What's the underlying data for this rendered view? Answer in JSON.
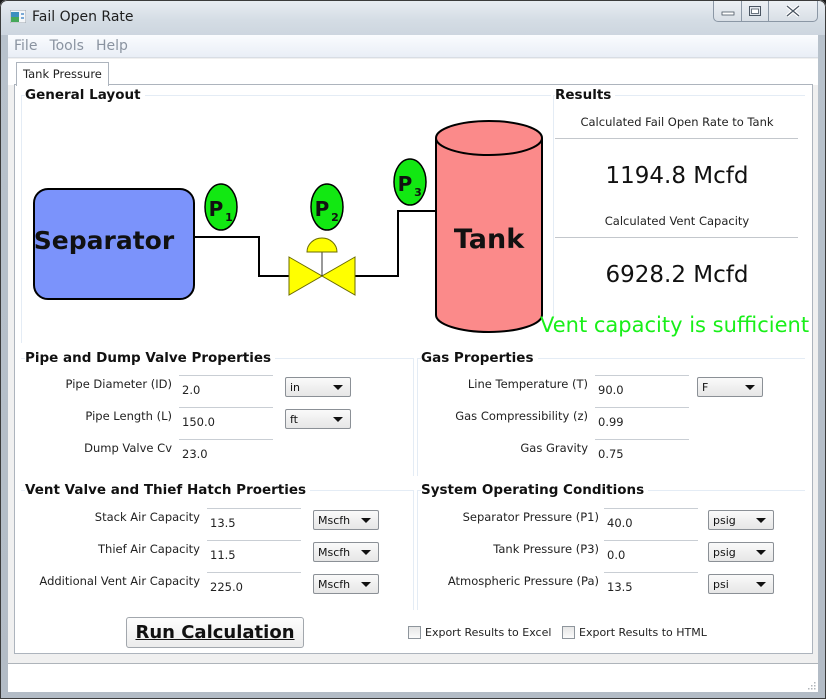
{
  "window": {
    "title": "Fail Open Rate",
    "icon": "app-window-icon",
    "controls": {
      "minimize": "minimize-icon",
      "maximize": "maximize-icon",
      "close": "close-icon"
    }
  },
  "menu": {
    "items": [
      {
        "label": "File"
      },
      {
        "label": "Tools"
      },
      {
        "label": "Help"
      }
    ]
  },
  "tabs": [
    {
      "label": "Tank Pressure",
      "active": true
    }
  ],
  "layout": {
    "title": "General Layout",
    "diagram": {
      "separator_label": "Separator",
      "tank_label": "Tank",
      "gauges": [
        {
          "p": "P",
          "sub": "1"
        },
        {
          "p": "P",
          "sub": "2"
        },
        {
          "p": "P",
          "sub": "3"
        }
      ],
      "colors": {
        "separator": "#7b93fb",
        "tank": "#fb8a8a",
        "gauge": "#12e812",
        "valve": "#ffff00"
      }
    }
  },
  "results": {
    "title": "Results",
    "fail_open_label": "Calculated Fail Open Rate to Tank",
    "fail_open_value": "1194.8 Mcfd",
    "vent_label": "Calculated Vent Capacity",
    "vent_value": "6928.2 Mcfd",
    "status_message": "Vent capacity is sufficient",
    "status_color": "#19ef19"
  },
  "pipe": {
    "title": "Pipe and Dump Valve Properties",
    "fields": [
      {
        "label": "Pipe Diameter (ID)",
        "value": "2.0",
        "unit": "in"
      },
      {
        "label": "Pipe Length (L)",
        "value": "150.0",
        "unit": "ft"
      },
      {
        "label": "Dump Valve Cv",
        "value": "23.0"
      }
    ]
  },
  "gas": {
    "title": "Gas Properties",
    "fields": [
      {
        "label": "Line Temperature (T)",
        "value": "90.0",
        "unit": "F"
      },
      {
        "label": "Gas Compressibility (z)",
        "value": "0.99"
      },
      {
        "label": "Gas Gravity",
        "value": "0.75"
      }
    ]
  },
  "vent": {
    "title": "Vent Valve and Thief Hatch Proerties",
    "fields": [
      {
        "label": "Stack Air Capacity",
        "value": "13.5",
        "unit": "Mscfh"
      },
      {
        "label": "Thief Air Capacity",
        "value": "11.5",
        "unit": "Mscfh"
      },
      {
        "label": "Additional Vent Air Capacity",
        "value": "225.0",
        "unit": "Mscfh"
      }
    ]
  },
  "system": {
    "title": "System Operating Conditions",
    "fields": [
      {
        "label": "Separator Pressure (P1)",
        "value": "40.0",
        "unit": "psig"
      },
      {
        "label": "Tank Pressure (P3)",
        "value": "0.0",
        "unit": "psig"
      },
      {
        "label": "Atmospheric Pressure (Pa)",
        "value": "13.5",
        "unit": "psi"
      }
    ]
  },
  "actions": {
    "run_label": "Run Calculation",
    "export_excel_label": "Export Results to Excel",
    "export_excel_checked": false,
    "export_html_label": "Export Results to HTML",
    "export_html_checked": false
  }
}
